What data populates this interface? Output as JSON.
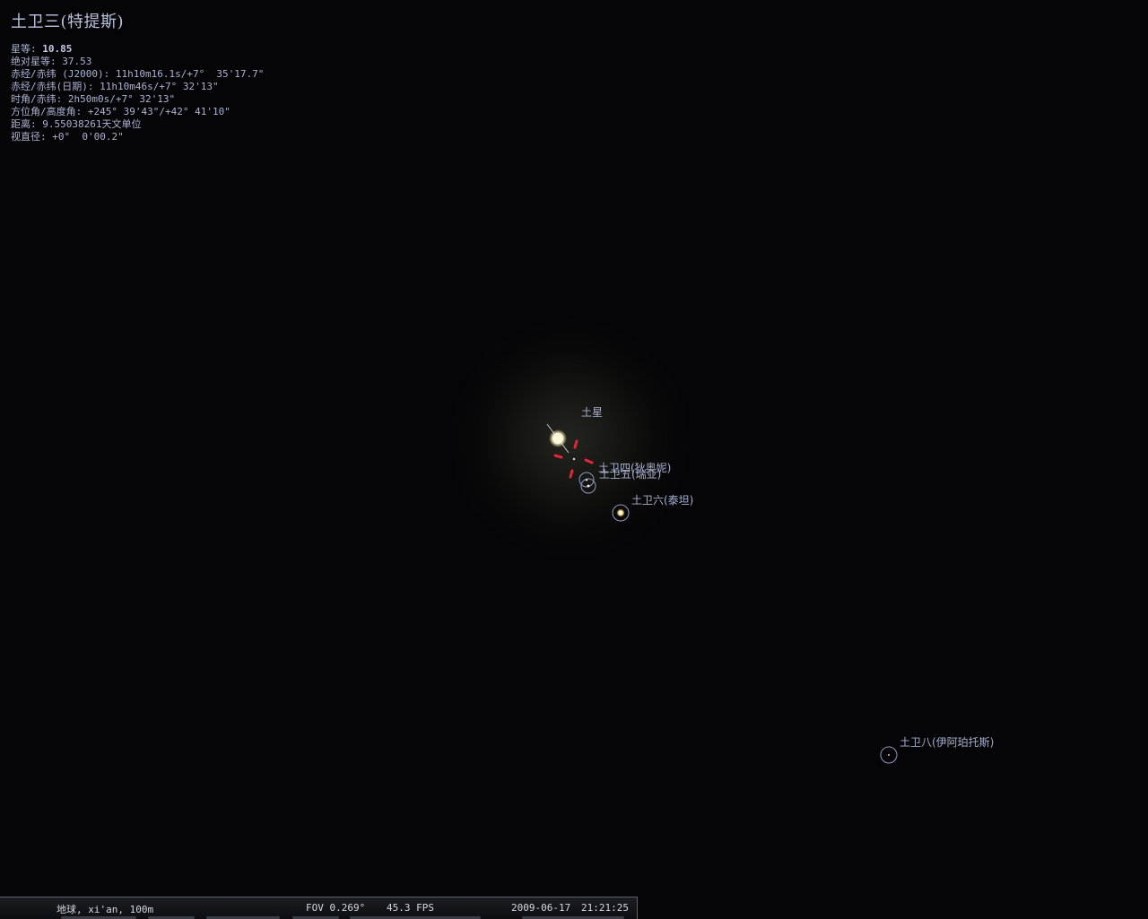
{
  "info_panel": {
    "object_name": "土卫三(特提斯)",
    "magnitude_label": "星等: ",
    "magnitude_value": "10.85",
    "abs_magnitude": "绝对星等: 37.53",
    "ra_dec_j2000": "赤经/赤纬 (J2000): 11h10m16.1s/+7°  35'17.7\"",
    "ra_dec_date": "赤经/赤纬(日期): 11h10m46s/+7° 32'13\"",
    "hour_angle": "时角/赤纬: 2h50m0s/+7° 32'13\"",
    "az_alt": "方位角/高度角: +245° 39'43\"/+42° 41'10\"",
    "distance": "距离: 9.55038261天文单位",
    "angular_size": "视直径: +0°  0'00.2\""
  },
  "sky_labels": {
    "saturn": "土星",
    "dione": "土卫四(狄奥妮)",
    "rhea": "土卫五(瑞亚)",
    "titan": "土卫六(泰坦)",
    "iapetus": "土卫八(伊阿珀托斯)"
  },
  "status_bar": {
    "location": "地球, xi'an, 100m",
    "fov": "FOV 0.269°",
    "fps": "45.3 FPS",
    "date": "2009-06-17",
    "time": "21:21:25"
  },
  "colors": {
    "background": "#050507",
    "info_text": "#aab2d2",
    "label_text": "#a6afd0",
    "selection_marker": "#e0283c",
    "moon_circle": "#8f97c2"
  }
}
